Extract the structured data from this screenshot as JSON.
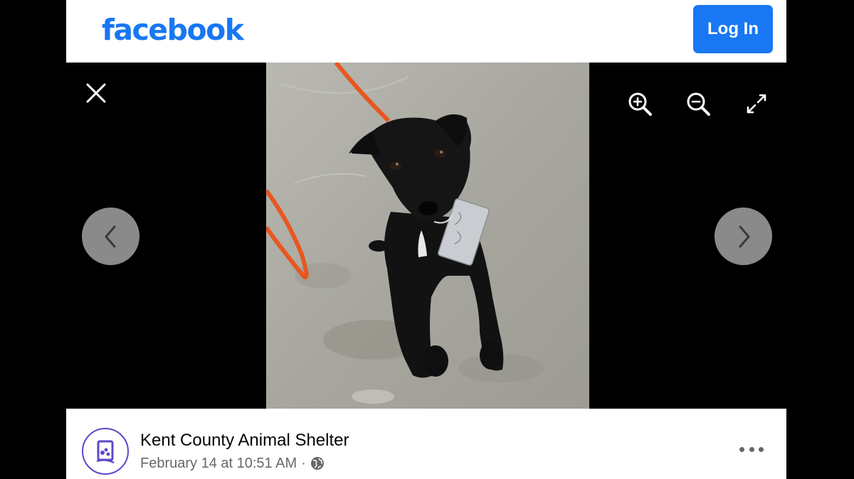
{
  "header": {
    "logo_text": "facebook",
    "login_label": "Log In"
  },
  "viewer": {
    "close_icon": "close-icon",
    "tools": [
      "zoom-in-icon",
      "zoom-out-icon",
      "expand-icon"
    ],
    "prev_icon": "chevron-left-icon",
    "next_icon": "chevron-right-icon",
    "photo_subject": "black dog on orange leash"
  },
  "post": {
    "page_name": "Kent County Animal Shelter",
    "timestamp": "February 14 at 10:51 AM",
    "separator": "·",
    "audience_icon": "globe-icon",
    "more_icon": "more-options-icon"
  },
  "colors": {
    "brand": "#1877f2",
    "viewer_bg": "#000000",
    "nav_button": "#8a8a8a",
    "secondary_text": "#65676b",
    "leash": "#e8571e"
  }
}
